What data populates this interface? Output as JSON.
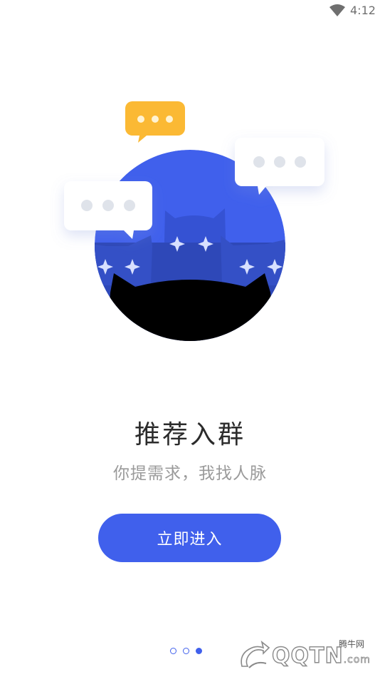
{
  "status_bar": {
    "time": "4:12",
    "wifi_icon": "wifi-icon"
  },
  "onboarding": {
    "title": "推荐入群",
    "subtitle": "你提需求，我找人脉",
    "button_label": "立即进入",
    "page_count": 3,
    "current_page": 3
  },
  "illustration": {
    "bubble_icon": "chat-bubble-icon",
    "accent_color": "#4060ec",
    "bubble_accent_color": "#fbb934"
  },
  "watermark": {
    "brand": "QQTN",
    "suffix": ".com",
    "chinese_name": "腾牛网"
  }
}
